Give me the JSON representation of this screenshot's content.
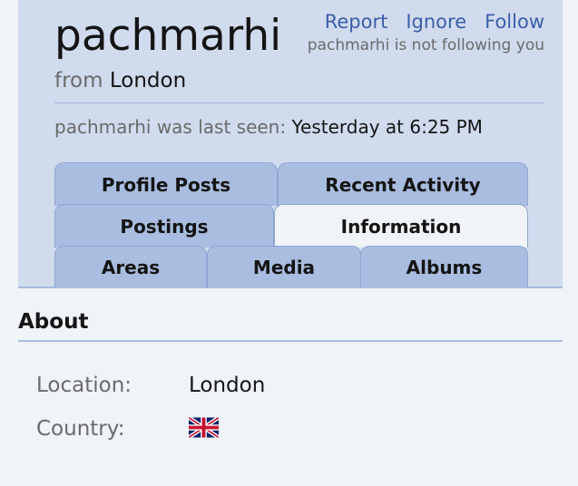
{
  "profile": {
    "username": "pachmarhi",
    "from_prefix": "from",
    "from_city": "London",
    "follow_status": "pachmarhi is not following you",
    "last_seen_label": "pachmarhi was last seen:",
    "last_seen_time": "Yesterday at 6:25 PM"
  },
  "actions": {
    "report": "Report",
    "ignore": "Ignore",
    "follow": "Follow"
  },
  "tabs": {
    "profile_posts": "Profile Posts",
    "recent_activity": "Recent Activity",
    "postings": "Postings",
    "information": "Information",
    "areas": "Areas",
    "media": "Media",
    "albums": "Albums",
    "active": "Information"
  },
  "about": {
    "title": "About",
    "location_label": "Location:",
    "location_value": "London",
    "country_label": "Country:",
    "country_flag": "uk-flag-icon"
  },
  "colors": {
    "header_bg": "#d1dbee",
    "tab_bg": "#a8bde0",
    "link": "#3b5ea9"
  }
}
